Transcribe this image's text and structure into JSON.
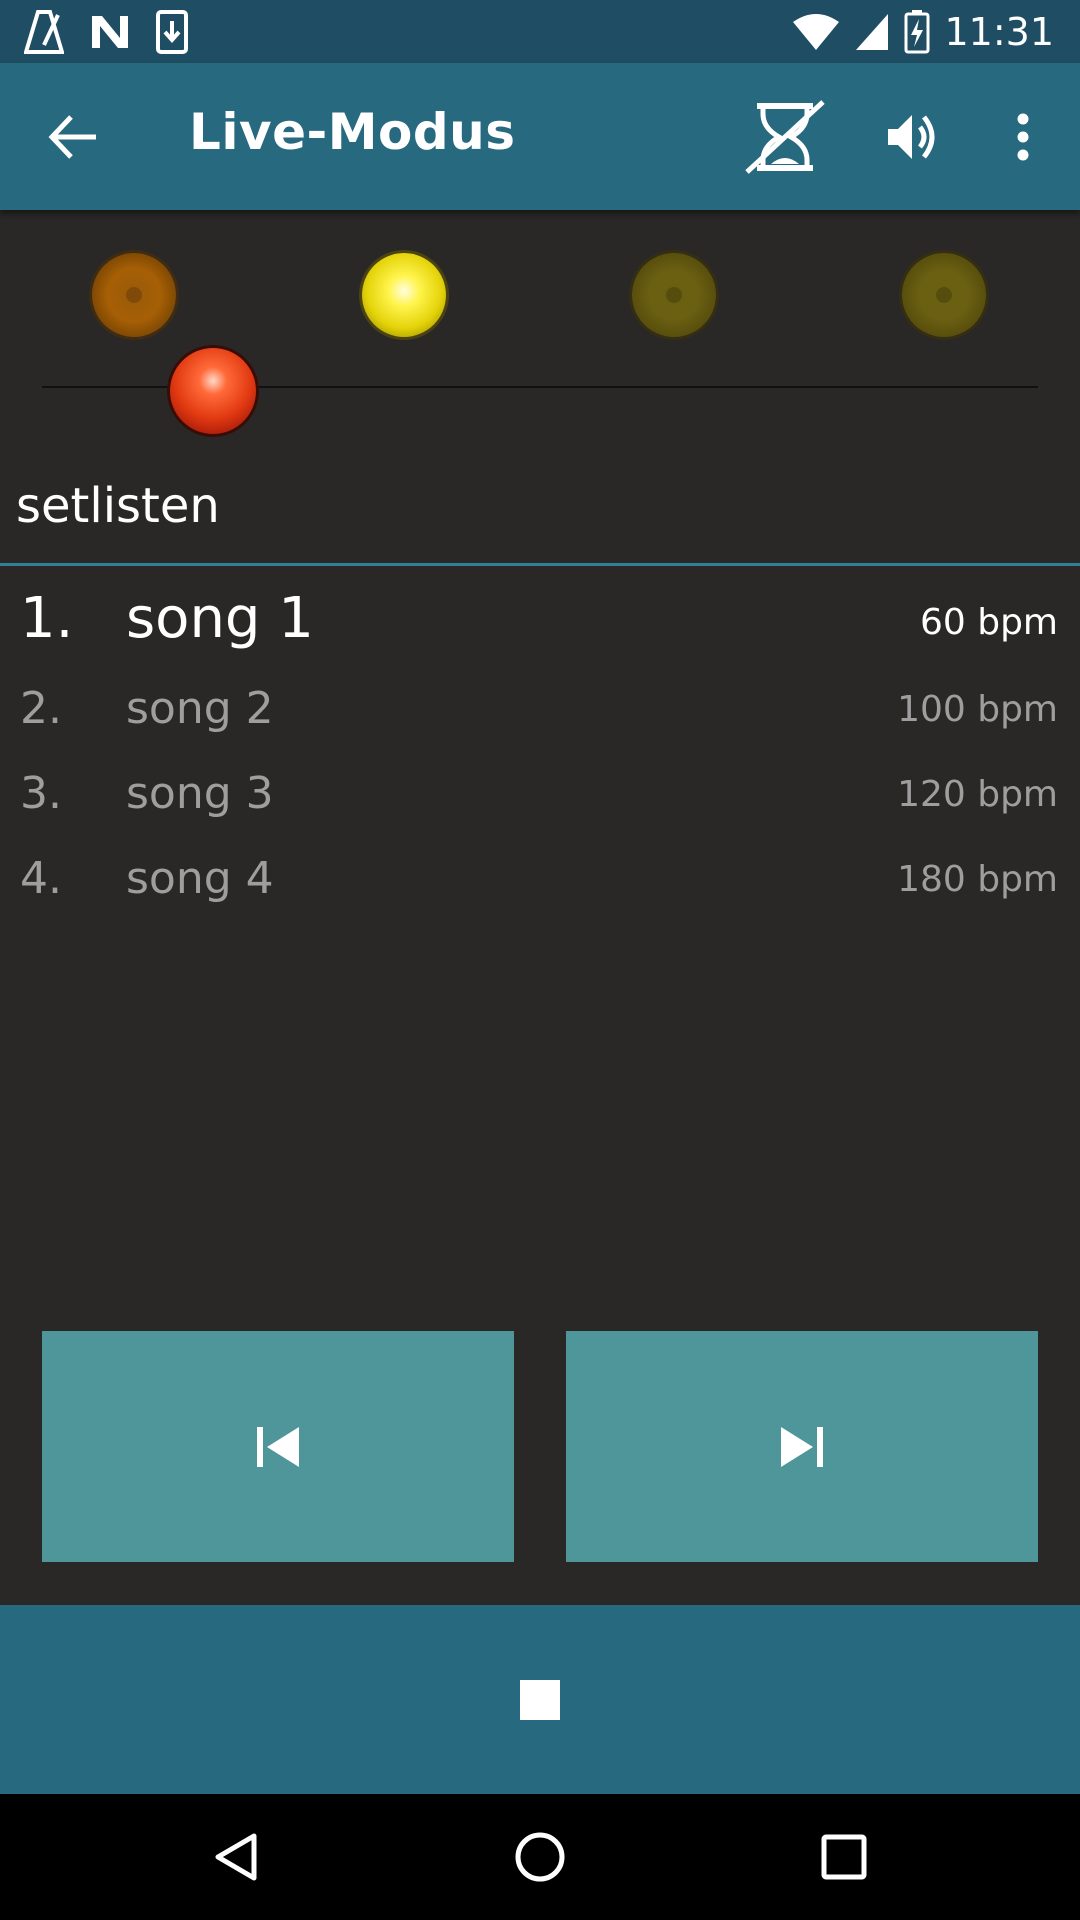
{
  "status_bar": {
    "time": "11:31",
    "icons_left": [
      "metronome-icon",
      "n-icon",
      "download-icon"
    ],
    "icons_right": [
      "wifi-icon",
      "signal-icon",
      "battery-charging-icon"
    ]
  },
  "app_bar": {
    "title": "Live-Modus",
    "back_icon": "arrow-back-icon",
    "actions": [
      "timer-off-icon",
      "volume-icon",
      "overflow-menu-icon"
    ]
  },
  "beat_lights": [
    {
      "color": "#a65f05",
      "state": "dim"
    },
    {
      "color": "#f3e41c",
      "state": "on"
    },
    {
      "color": "#6b6012",
      "state": "dim"
    },
    {
      "color": "#6b6012",
      "state": "dim"
    }
  ],
  "pendulum": {
    "color": "#e23a12"
  },
  "setlist": {
    "name": "setlisten",
    "songs": [
      {
        "number": "1.",
        "title": "song 1",
        "bpm": "60 bpm",
        "active": true
      },
      {
        "number": "2.",
        "title": "song 2",
        "bpm": "100 bpm",
        "active": false
      },
      {
        "number": "3.",
        "title": "song 3",
        "bpm": "120 bpm",
        "active": false
      },
      {
        "number": "4.",
        "title": "song 4",
        "bpm": "180 bpm",
        "active": false
      }
    ]
  },
  "controls": {
    "previous_icon": "skip-previous-icon",
    "next_icon": "skip-next-icon",
    "stop_icon": "stop-icon",
    "button_color": "#4f969b",
    "bar_color": "#27697f"
  },
  "system_nav": [
    "back-triangle-icon",
    "home-circle-icon",
    "recents-square-icon"
  ]
}
